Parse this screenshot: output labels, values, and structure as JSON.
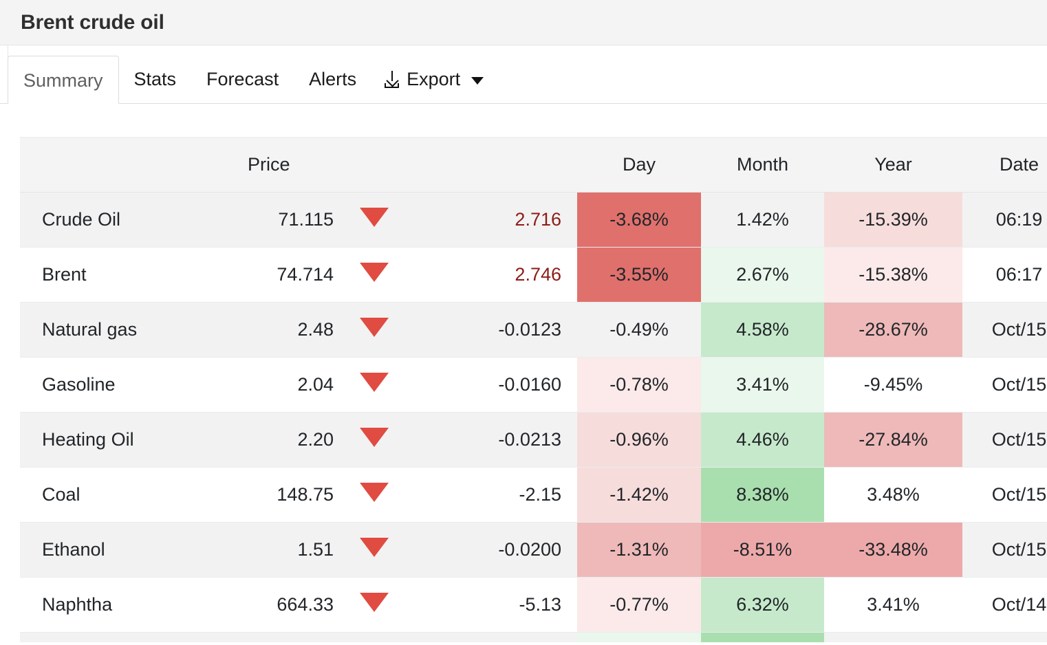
{
  "header": {
    "title": "Brent crude oil"
  },
  "tabs": [
    {
      "label": "Summary",
      "active": true
    },
    {
      "label": "Stats",
      "active": false
    },
    {
      "label": "Forecast",
      "active": false
    },
    {
      "label": "Alerts",
      "active": false
    }
  ],
  "export": {
    "label": "Export",
    "icon": "download-icon",
    "caret": "chevron-down-icon"
  },
  "table": {
    "columns": [
      "",
      "Price",
      "",
      "",
      "Day",
      "Month",
      "Year",
      "Date"
    ],
    "headers": {
      "name": "",
      "price": "Price",
      "arrow": "",
      "change": "",
      "day": "Day",
      "month": "Month",
      "year": "Year",
      "date": "Date"
    },
    "rows": [
      {
        "name": "Crude Oil",
        "price": "71.115",
        "direction": "down",
        "change": "2.716",
        "change_style": "neg-strong",
        "day": "-3.68%",
        "day_heat": "red-5",
        "month": "1.42%",
        "month_heat": "none",
        "year": "-15.39%",
        "year_heat": "red-2",
        "date": "06:19"
      },
      {
        "name": "Brent",
        "price": "74.714",
        "direction": "down",
        "change": "2.746",
        "change_style": "neg-strong",
        "day": "-3.55%",
        "day_heat": "red-5",
        "month": "2.67%",
        "month_heat": "green-1",
        "year": "-15.38%",
        "year_heat": "red-1",
        "date": "06:17"
      },
      {
        "name": "Natural gas",
        "price": "2.48",
        "direction": "down",
        "change": "-0.0123",
        "change_style": "plain",
        "day": "-0.49%",
        "day_heat": "none",
        "month": "4.58%",
        "month_heat": "green-3",
        "year": "-28.67%",
        "year_heat": "red-3",
        "date": "Oct/15"
      },
      {
        "name": "Gasoline",
        "price": "2.04",
        "direction": "down",
        "change": "-0.0160",
        "change_style": "plain",
        "day": "-0.78%",
        "day_heat": "red-1",
        "month": "3.41%",
        "month_heat": "green-1",
        "year": "-9.45%",
        "year_heat": "none",
        "date": "Oct/15"
      },
      {
        "name": "Heating Oil",
        "price": "2.20",
        "direction": "down",
        "change": "-0.0213",
        "change_style": "plain",
        "day": "-0.96%",
        "day_heat": "red-2",
        "month": "4.46%",
        "month_heat": "green-3",
        "year": "-27.84%",
        "year_heat": "red-3",
        "date": "Oct/15"
      },
      {
        "name": "Coal",
        "price": "148.75",
        "direction": "down",
        "change": "-2.15",
        "change_style": "plain",
        "day": "-1.42%",
        "day_heat": "red-2",
        "month": "8.38%",
        "month_heat": "green-4",
        "year": "3.48%",
        "year_heat": "none",
        "date": "Oct/15"
      },
      {
        "name": "Ethanol",
        "price": "1.51",
        "direction": "down",
        "change": "-0.0200",
        "change_style": "plain",
        "day": "-1.31%",
        "day_heat": "red-3",
        "month": "-8.51%",
        "month_heat": "red-4",
        "year": "-33.48%",
        "year_heat": "red-4",
        "date": "Oct/15"
      },
      {
        "name": "Naphtha",
        "price": "664.33",
        "direction": "down",
        "change": "-5.13",
        "change_style": "plain",
        "day": "-0.77%",
        "day_heat": "red-1",
        "month": "6.32%",
        "month_heat": "green-3",
        "year": "3.41%",
        "year_heat": "none",
        "date": "Oct/14"
      }
    ],
    "partial_row": {
      "day_heat": "green-1",
      "month_heat": "green-4"
    }
  },
  "colors": {
    "accent_down_arrow": "#e04b42",
    "change_negative_text": "#8d1c16",
    "red-1": "#fbeae9",
    "red-2": "#f6dcdb",
    "red-3": "#eeb9b8",
    "red-4": "#eda9a9",
    "red-5": "#e0706c",
    "green-1": "#eaf7ec",
    "green-2": "#d9f0dd",
    "green-3": "#c6e9cb",
    "green-4": "#a9dfae",
    "header_bg": "#f4f4f4",
    "stripe_bg": "#f2f2f2"
  }
}
